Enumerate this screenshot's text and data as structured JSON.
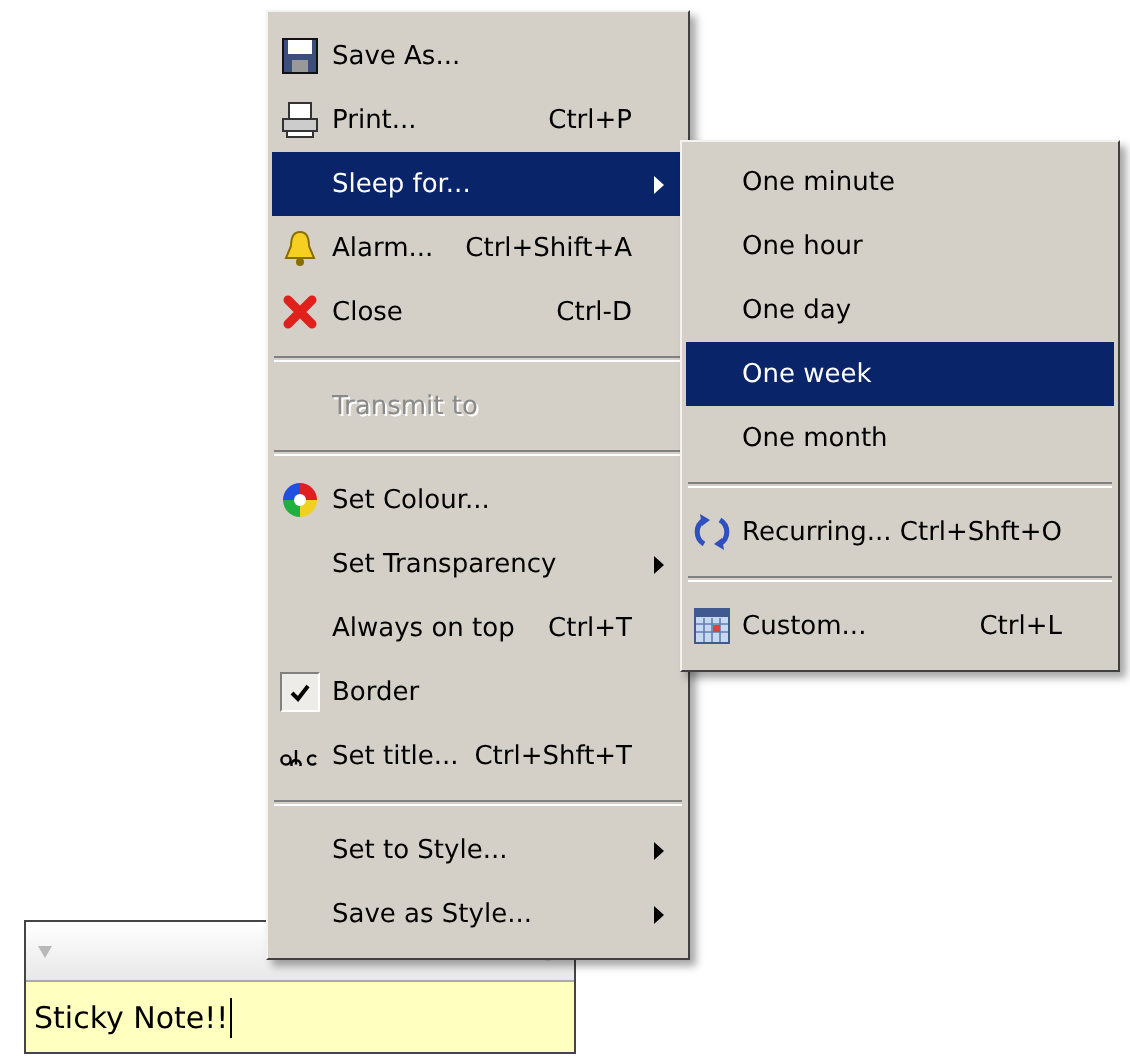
{
  "sticky_note": {
    "value": "Sticky Note!!"
  },
  "main_menu": {
    "items": [
      {
        "kind": "item",
        "label": "Save As...",
        "selected": false,
        "disabled": false,
        "checked": false,
        "submenu": false
      },
      {
        "kind": "item",
        "label": "Print...",
        "shortcut": "Ctrl+P",
        "selected": false,
        "disabled": false,
        "checked": false,
        "submenu": false
      },
      {
        "kind": "item",
        "label": "Sleep for...",
        "selected": true,
        "disabled": false,
        "checked": false,
        "submenu": true
      },
      {
        "kind": "item",
        "label": "Alarm...",
        "shortcut": "Ctrl+Shift+A",
        "selected": false,
        "disabled": false,
        "checked": false,
        "submenu": false
      },
      {
        "kind": "item",
        "label": "Close",
        "shortcut": "Ctrl-D",
        "selected": false,
        "disabled": false,
        "checked": false,
        "submenu": false
      },
      {
        "kind": "separator"
      },
      {
        "kind": "item",
        "label": "Transmit to",
        "selected": false,
        "disabled": true,
        "checked": false,
        "submenu": false
      },
      {
        "kind": "separator"
      },
      {
        "kind": "item",
        "label": "Set Colour...",
        "selected": false,
        "disabled": false,
        "checked": false,
        "submenu": false
      },
      {
        "kind": "item",
        "label": "Set Transparency",
        "selected": false,
        "disabled": false,
        "checked": false,
        "submenu": true
      },
      {
        "kind": "item",
        "label": "Always on top",
        "shortcut": "Ctrl+T",
        "selected": false,
        "disabled": false,
        "checked": false,
        "submenu": false
      },
      {
        "kind": "item",
        "label": "Border",
        "selected": false,
        "disabled": false,
        "checked": true,
        "submenu": false
      },
      {
        "kind": "item",
        "label": "Set title...",
        "shortcut": "Ctrl+Shft+T",
        "selected": false,
        "disabled": false,
        "checked": false,
        "submenu": false
      },
      {
        "kind": "separator"
      },
      {
        "kind": "item",
        "label": "Set to Style...",
        "selected": false,
        "disabled": false,
        "checked": false,
        "submenu": true
      },
      {
        "kind": "item",
        "label": "Save as Style...",
        "selected": false,
        "disabled": false,
        "checked": false,
        "submenu": true
      }
    ]
  },
  "sleep_submenu": {
    "items": [
      {
        "kind": "item",
        "label": "One minute",
        "selected": false
      },
      {
        "kind": "item",
        "label": "One hour",
        "selected": false
      },
      {
        "kind": "item",
        "label": "One day",
        "selected": false
      },
      {
        "kind": "item",
        "label": "One week",
        "selected": true
      },
      {
        "kind": "item",
        "label": "One month",
        "selected": false
      },
      {
        "kind": "separator"
      },
      {
        "kind": "item",
        "label": "Recurring...",
        "shortcut": "Ctrl+Shft+O",
        "selected": false
      },
      {
        "kind": "separator"
      },
      {
        "kind": "item",
        "label": "Custom...",
        "shortcut": "Ctrl+L",
        "selected": false
      }
    ]
  }
}
